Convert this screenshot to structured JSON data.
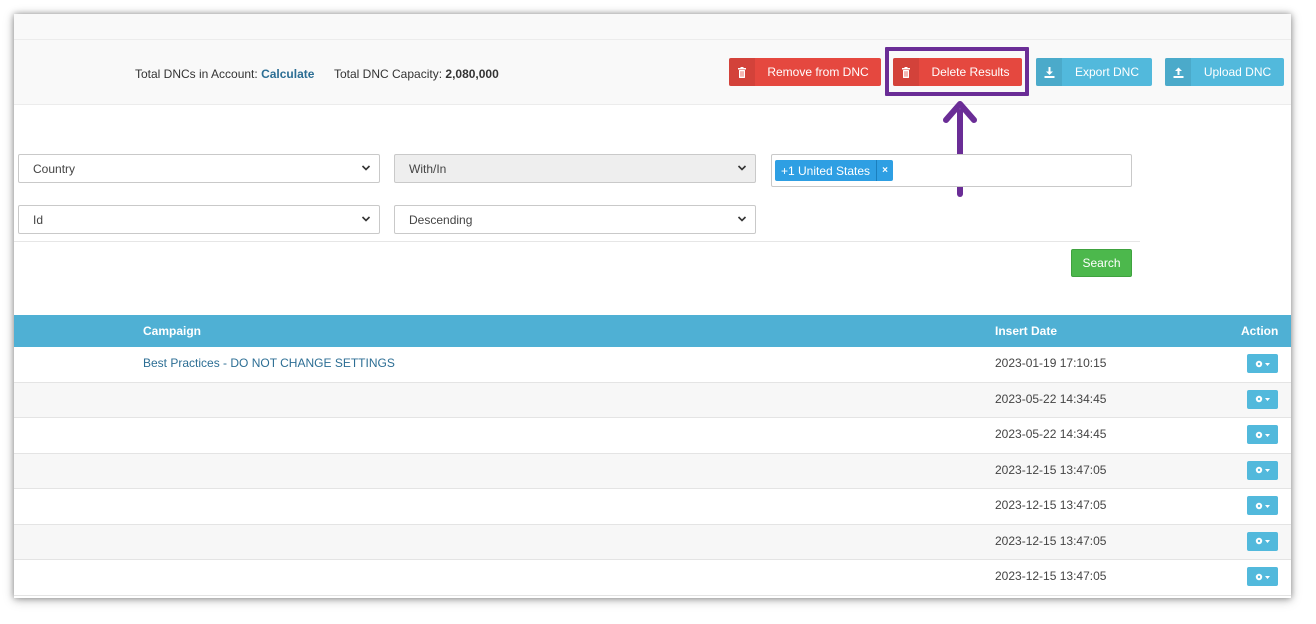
{
  "stats": {
    "total_dncs_label": "Total DNCs in Account:",
    "total_dncs_link": "Calculate",
    "capacity_label": "Total DNC Capacity:",
    "capacity_value": "2,080,000"
  },
  "toolbar": {
    "remove_label": "Remove from DNC",
    "delete_label": "Delete Results",
    "export_label": "Export DNC",
    "upload_label": "Upload DNC"
  },
  "filters": {
    "field_select": "Country",
    "operator_select": "With/In",
    "value_tag": "+1 United States",
    "sort_field_select": "Id",
    "sort_order_select": "Descending",
    "search_label": "Search"
  },
  "table": {
    "headers": {
      "campaign": "Campaign",
      "insert_date": "Insert Date",
      "action": "Action"
    },
    "rows": [
      {
        "campaign": "Best Practices - DO NOT CHANGE SETTINGS",
        "insert_date": "2023-01-19 17:10:15"
      },
      {
        "campaign": "",
        "insert_date": "2023-05-22 14:34:45"
      },
      {
        "campaign": "",
        "insert_date": "2023-05-22 14:34:45"
      },
      {
        "campaign": "",
        "insert_date": "2023-12-15 13:47:05"
      },
      {
        "campaign": "",
        "insert_date": "2023-12-15 13:47:05"
      },
      {
        "campaign": "",
        "insert_date": "2023-12-15 13:47:05"
      },
      {
        "campaign": "",
        "insert_date": "2023-12-15 13:47:05"
      }
    ]
  },
  "colors": {
    "danger": "#e5483f",
    "info": "#52b9dc",
    "success": "#4cb84c",
    "table_header": "#4fb0d4",
    "highlight": "#6a2d96",
    "link": "#2c6e94"
  },
  "icons": {
    "remove_icon": "trash-icon",
    "delete_icon": "trash-icon",
    "export_icon": "download-icon",
    "upload_icon": "upload-icon",
    "action_icon": "gear-dropdown-icon",
    "annotation": "arrow-up-icon"
  }
}
